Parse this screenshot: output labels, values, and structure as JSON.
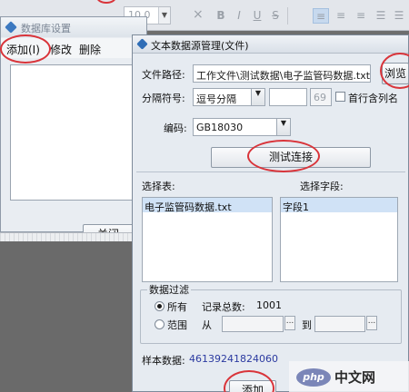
{
  "toolbar": {
    "font_size": "10.0",
    "bold": "B",
    "italic": "I",
    "underline": "U",
    "strike": "S",
    "align_left": "≡",
    "align_center": "≡",
    "align_right": "≡",
    "close": "×"
  },
  "back_dialog": {
    "title": "数据库设置",
    "menu": {
      "add": "添加(I)",
      "edit": "修改",
      "delete": "删除"
    },
    "close_button": "关闭"
  },
  "dialog": {
    "title": "文本数据源管理(文件)",
    "file_path": {
      "label": "文件路径:",
      "value": "工作文件\\测试数据\\电子监管码数据.txt",
      "browse": "浏览"
    },
    "separator": {
      "label": "分隔符号:",
      "value": "逗号分隔",
      "custom_value": "",
      "custom_value2": "69",
      "header_checkbox_label": "首行含列名"
    },
    "encoding": {
      "label": "编码:",
      "value": "GB18030"
    },
    "test_button": "测试连接",
    "select_table_label": "选择表:",
    "select_field_label": "选择字段:",
    "tables": [
      "电子监管码数据.txt"
    ],
    "fields": [
      "字段1"
    ],
    "filter": {
      "legend": "数据过滤",
      "all_label": "所有",
      "record_total_label": "记录总数:",
      "record_total_value": "1001",
      "range_label": "范围",
      "from_label": "从",
      "to_label": "到",
      "ellipsis": "..."
    },
    "sample": {
      "label": "样本数据:",
      "value": "46139241824060"
    },
    "add_button": "添加"
  },
  "watermark": {
    "logo": "php",
    "text": "中文网"
  },
  "colors": {
    "annotation_ring": "#d9343a",
    "selection": "#d0e2f6",
    "sample_text": "#2b3aa0"
  },
  "icons": {
    "toolbar_close": "close-icon",
    "dialog_title": "app-diamond-icon",
    "combo": "chevron-down-icon",
    "ellipsis": "ellipsis-icon"
  }
}
